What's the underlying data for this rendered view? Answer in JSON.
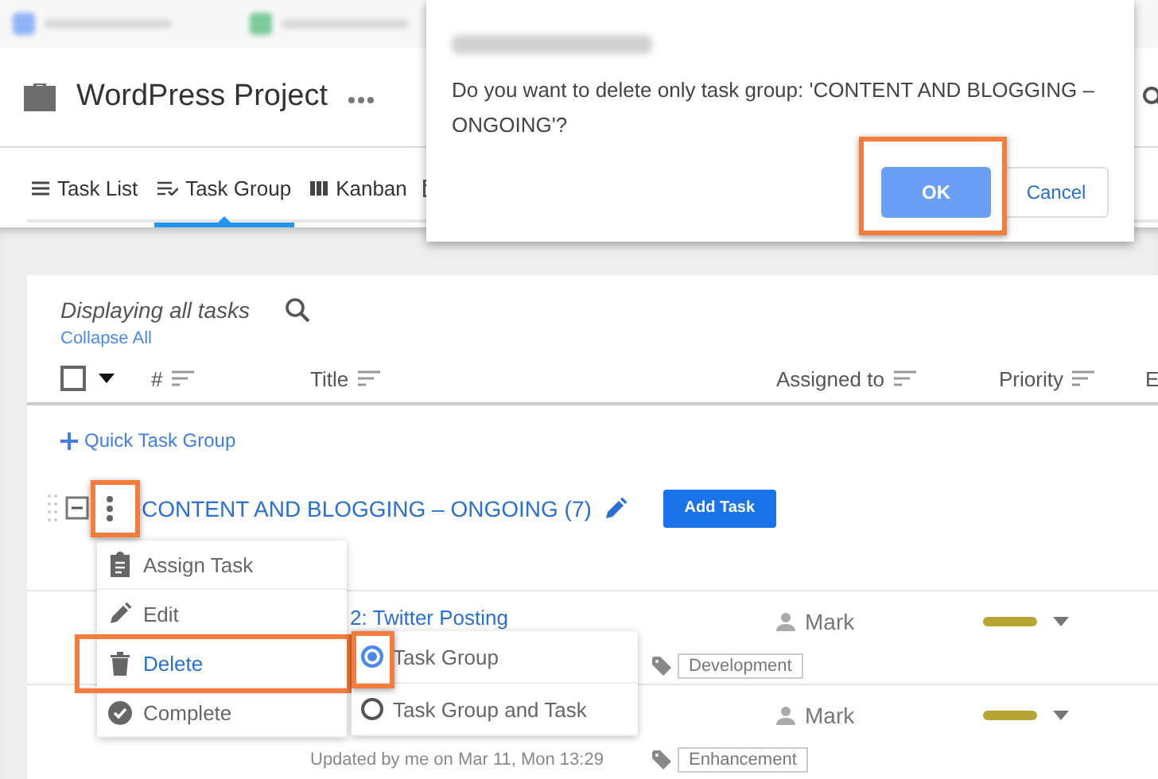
{
  "header": {
    "title": "WordPress Project"
  },
  "view_tabs": [
    {
      "label": "Task List",
      "kind": "list",
      "selected": false
    },
    {
      "label": "Task Group",
      "kind": "group",
      "selected": true
    },
    {
      "label": "Kanban",
      "kind": "kanban",
      "selected": false
    }
  ],
  "task_list": {
    "caption": "Displaying all tasks",
    "collapse_link": "Collapse All",
    "select_all": {
      "checked": false
    },
    "columns": [
      "#",
      "Title",
      "Assigned to",
      "Priority",
      "E"
    ],
    "quick_add": "Quick Task Group",
    "group": {
      "title": "CONTENT AND BLOGGING – ONGOING (7)",
      "expanded": true,
      "add_button": "Add Task"
    },
    "tasks": [
      {
        "title": "2: Twitter Posting",
        "assignee": "Mark",
        "tag": "Development"
      },
      {
        "updated": "Updated by me on Mar 11, Mon 13:29",
        "assignee": "Mark",
        "tag": "Enhancement"
      }
    ]
  },
  "context_menu": [
    {
      "label": "Assign Task",
      "kind": "assign",
      "selected": false
    },
    {
      "label": "Edit",
      "kind": "edit",
      "selected": false
    },
    {
      "label": "Delete",
      "kind": "delete",
      "selected": true
    },
    {
      "label": "Complete",
      "kind": "complete",
      "selected": false
    }
  ],
  "delete_options": [
    {
      "label": "Task Group",
      "selected": true
    },
    {
      "label": "Task Group and Task",
      "selected": false
    }
  ],
  "dialog": {
    "message": "Do you want to delete only task group: 'CONTENT AND BLOGGING – ONGOING'?",
    "ok": "OK",
    "cancel": "Cancel"
  }
}
